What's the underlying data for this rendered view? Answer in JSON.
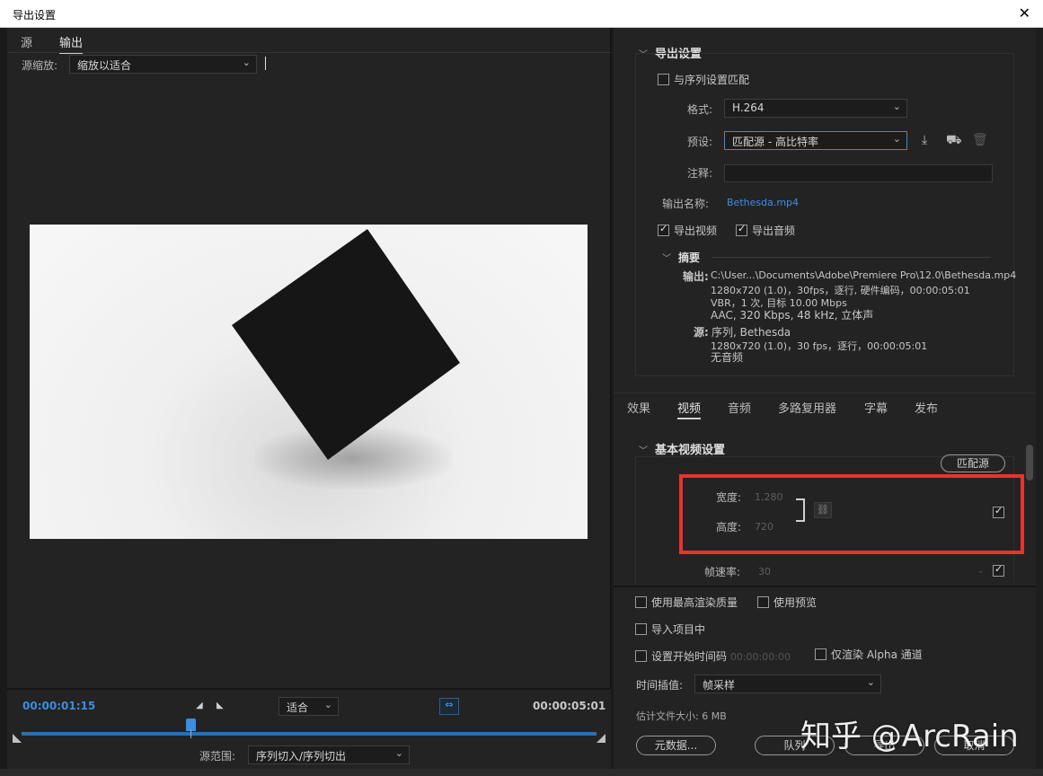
{
  "window": {
    "title": "导出设置",
    "close": "✕"
  },
  "left": {
    "tabs": [
      "源",
      "输出"
    ],
    "active_tab": "输出",
    "scale_label": "源缩放:",
    "scale_value": "缩放以适合",
    "timeline": {
      "current_time": "00:00:01:15",
      "end_time": "00:00:05:01",
      "zoom_value": "适合",
      "range_label": "源范围:",
      "range_value": "序列切入/序列切出"
    }
  },
  "export": {
    "section_title": "导出设置",
    "match_sequence": "与序列设置匹配",
    "format_label": "格式:",
    "format_value": "H.264",
    "preset_label": "预设:",
    "preset_value": "匹配源 - 高比特率",
    "comment_label": "注释:",
    "output_name_label": "输出名称:",
    "output_name_value": "Bethesda.mp4",
    "export_video": "导出视频",
    "export_audio": "导出音频",
    "summary": {
      "title": "摘要",
      "output_label": "输出:",
      "output_lines": [
        "C:\\User...\\Documents\\Adobe\\Premiere Pro\\12.0\\Bethesda.mp4",
        "1280x720 (1.0)，30fps，逐行, 硬件编码，00:00:05:01",
        "VBR，1 次, 目标 10.00 Mbps",
        "AAC, 320 Kbps, 48  kHz, 立体声"
      ],
      "source_label": "源:",
      "source_lines": [
        "序列, Bethesda",
        "1280x720 (1.0)，30 fps，逐行，00:00:05:01",
        "无音频"
      ]
    }
  },
  "tabs": [
    "效果",
    "视频",
    "音频",
    "多路复用器",
    "字幕",
    "发布"
  ],
  "active_tab": "视频",
  "video": {
    "section_title": "基本视频设置",
    "match_source": "匹配源",
    "width_label": "宽度:",
    "width_value": "1,280",
    "height_label": "高度:",
    "height_value": "720",
    "framerate_label": "帧速率:",
    "framerate_value": "30"
  },
  "bottom": {
    "max_render": "使用最高渲染质量",
    "use_preview": "使用预览",
    "import_project": "导入项目中",
    "set_start_tc": "设置开始时间码",
    "start_tc_value": "00:00:00:00",
    "alpha_only": "仅渲染 Alpha 通道",
    "interp_label": "时间插值:",
    "interp_value": "帧采样",
    "filesize_label": "估计文件大小:",
    "filesize_value": "6 MB",
    "metadata_btn": "元数据...",
    "queue_btn": "队列",
    "export_btn": "导出",
    "cancel_btn": "取消"
  },
  "watermark": "知乎 @ArcRain",
  "colors": {
    "accent": "#3a8ee0",
    "highlight": "#e8332f",
    "panel": "#232323"
  }
}
